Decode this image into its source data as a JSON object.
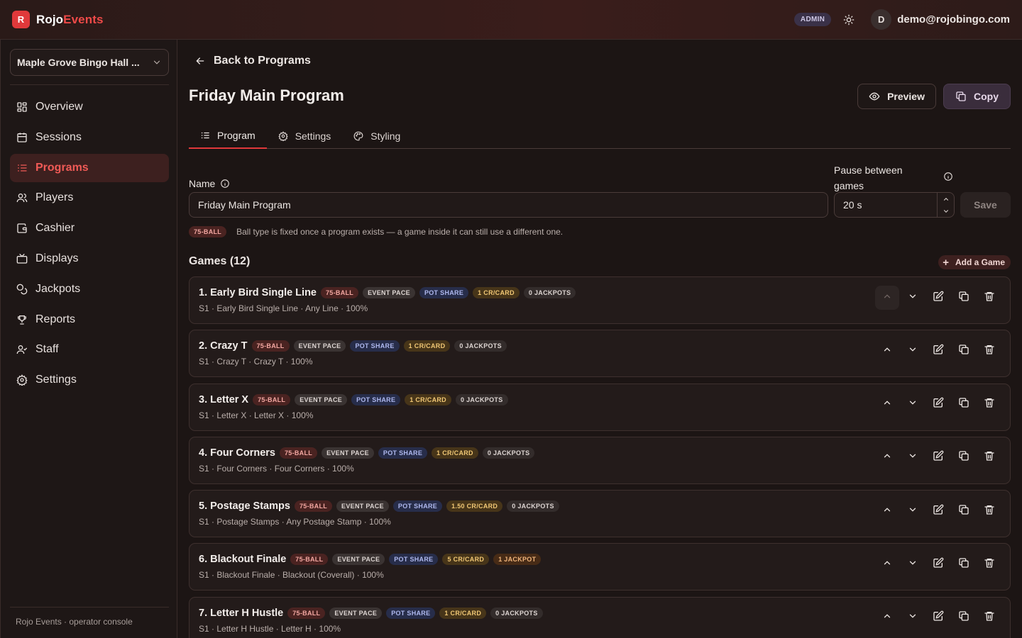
{
  "app": {
    "logo_letter": "R",
    "brand_part1": "Rojo",
    "brand_part2": "Events",
    "role_badge": "ADMIN",
    "user_initial": "D",
    "user_email": "demo@rojobingo.com",
    "accent_color": "#e0393b"
  },
  "sidebar": {
    "venue": "Maple Grove Bingo Hall ...",
    "items": [
      {
        "label": "Overview",
        "icon": "grid-icon"
      },
      {
        "label": "Sessions",
        "icon": "calendar-icon"
      },
      {
        "label": "Programs",
        "icon": "list-icon",
        "active": true
      },
      {
        "label": "Players",
        "icon": "users-icon"
      },
      {
        "label": "Cashier",
        "icon": "wallet-icon"
      },
      {
        "label": "Displays",
        "icon": "tv-icon"
      },
      {
        "label": "Jackpots",
        "icon": "coins-icon"
      },
      {
        "label": "Reports",
        "icon": "trophy-icon"
      },
      {
        "label": "Staff",
        "icon": "staff-icon"
      },
      {
        "label": "Settings",
        "icon": "gear-icon"
      }
    ],
    "footer": "Rojo Events · operator console"
  },
  "main": {
    "back_label": "Back to Programs",
    "title": "Friday Main Program",
    "preview_label": "Preview",
    "copy_label": "Copy",
    "tabs": [
      {
        "label": "Program",
        "icon": "list-icon",
        "active": true
      },
      {
        "label": "Settings",
        "icon": "gear-icon"
      },
      {
        "label": "Styling",
        "icon": "palette-icon"
      }
    ],
    "name_label": "Name",
    "name_value": "Friday Main Program",
    "pause_label": "Pause between games",
    "pause_value": "20 s",
    "save_label": "Save",
    "ball_type": "75-BALL",
    "ball_type_note": "Ball type is fixed once a program exists — a game inside it can still use a different one.",
    "games_title": "Games (12)",
    "add_game_label": "Add a Game",
    "games": [
      {
        "title": "1. Early Bird Single Line",
        "ball": "75-BALL",
        "pace": "EVENT PACE",
        "pot": "POT SHARE",
        "cr": "1 CR/CARD",
        "jp": "0 JACKPOTS",
        "sub": "S1 · Early Bird Single Line · Any Line · 100%"
      },
      {
        "title": "2. Crazy T",
        "ball": "75-BALL",
        "pace": "EVENT PACE",
        "pot": "POT SHARE",
        "cr": "1 CR/CARD",
        "jp": "0 JACKPOTS",
        "sub": "S1 · Crazy T · Crazy T · 100%"
      },
      {
        "title": "3. Letter X",
        "ball": "75-BALL",
        "pace": "EVENT PACE",
        "pot": "POT SHARE",
        "cr": "1 CR/CARD",
        "jp": "0 JACKPOTS",
        "sub": "S1 · Letter X · Letter X · 100%"
      },
      {
        "title": "4. Four Corners",
        "ball": "75-BALL",
        "pace": "EVENT PACE",
        "pot": "POT SHARE",
        "cr": "1 CR/CARD",
        "jp": "0 JACKPOTS",
        "sub": "S1 · Four Corners · Four Corners · 100%"
      },
      {
        "title": "5. Postage Stamps",
        "ball": "75-BALL",
        "pace": "EVENT PACE",
        "pot": "POT SHARE",
        "cr": "1.50 CR/CARD",
        "jp": "0 JACKPOTS",
        "sub": "S1 · Postage Stamps · Any Postage Stamp · 100%"
      },
      {
        "title": "6. Blackout Finale",
        "ball": "75-BALL",
        "pace": "EVENT PACE",
        "pot": "POT SHARE",
        "cr": "5 CR/CARD",
        "jp": "1 JACKPOT",
        "sub": "S1 · Blackout Finale · Blackout (Coverall) · 100%"
      },
      {
        "title": "7. Letter H Hustle",
        "ball": "75-BALL",
        "pace": "EVENT PACE",
        "pot": "POT SHARE",
        "cr": "1 CR/CARD",
        "jp": "0 JACKPOTS",
        "sub": "S1 · Letter H Hustle · Letter H · 100%"
      }
    ]
  }
}
